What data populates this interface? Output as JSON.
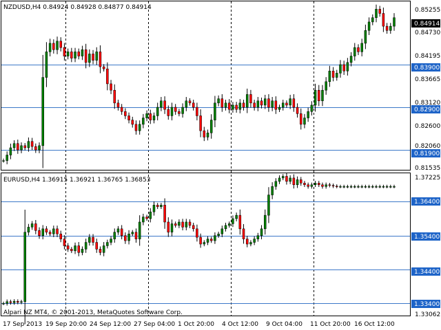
{
  "top": {
    "title": "NZDUSD,H4  0.84924 0.84928 0.84877 0.84914",
    "current_price": "0.84914",
    "price_ticks": [
      "0.85255",
      "0.84730",
      "0.84195",
      "0.83665",
      "0.83120",
      "0.82600",
      "0.82060",
      "0.81535"
    ],
    "level_labels": [
      "0.83900",
      "0.82900",
      "0.81900"
    ]
  },
  "bottom": {
    "title": "EURUSD,H4  1.36915 1.36921 1.36765 1.36853",
    "price_ticks": [
      "1.37225",
      "1.33062"
    ],
    "level_labels": [
      "1.36400",
      "1.35400",
      "1.34400",
      "1.33400"
    ]
  },
  "copyright": "Alpari NZ MT4, © 2001-2013, MetaQuotes Software Corp.",
  "time_labels": [
    "17 Sep 2013",
    "19 Sep 20:00",
    "24 Sep 12:00",
    "27 Sep 04:00",
    "1 Oct 20:00",
    "4 Oct 12:00",
    "9 Oct 04:00",
    "11 Oct 20:00",
    "16 Oct 12:00"
  ],
  "colors": {
    "up_candle": "#008000",
    "down_candle": "#ff0000",
    "bar_outline": "#000000",
    "level_line": "#3c78c8",
    "grid": "#000000",
    "label_highlight_bg": "#1e64c8",
    "current_price_bg": "#000000"
  },
  "chart_data": [
    {
      "type": "candlestick",
      "title": "NZDUSD,H4  0.84924 0.84928 0.84877 0.84914",
      "series": [
        {
          "name": "NZDUSD",
          "close": [
            0.8165,
            0.8178,
            0.8195,
            0.8205,
            0.819,
            0.82,
            0.8195,
            0.821,
            0.8198,
            0.819,
            0.82,
            0.836,
            0.842,
            0.844,
            0.8425,
            0.8445,
            0.843,
            0.841,
            0.842,
            0.8405,
            0.842,
            0.841,
            0.8425,
            0.8395,
            0.8415,
            0.84,
            0.842,
            0.8385,
            0.838,
            0.8345,
            0.833,
            0.83,
            0.829,
            0.828,
            0.827,
            0.826,
            0.825,
            0.8235,
            0.825,
            0.8265,
            0.8275,
            0.826,
            0.827,
            0.829,
            0.8305,
            0.8285,
            0.827,
            0.829,
            0.828,
            0.8275,
            0.829,
            0.8305,
            0.83,
            0.829,
            0.827,
            0.8235,
            0.822,
            0.823,
            0.826,
            0.83,
            0.831,
            0.829,
            0.83,
            0.8285,
            0.8295,
            0.8285,
            0.83,
            0.829,
            0.832,
            0.83,
            0.829,
            0.8305,
            0.8295,
            0.831,
            0.829,
            0.8305,
            0.8285,
            0.829,
            0.83,
            0.8295,
            0.831,
            0.829,
            0.8275,
            0.825,
            0.8265,
            0.828,
            0.8295,
            0.833,
            0.8305,
            0.833,
            0.835,
            0.8375,
            0.836,
            0.837,
            0.839,
            0.8375,
            0.8395,
            0.841,
            0.843,
            0.842,
            0.844,
            0.847,
            0.849,
            0.85,
            0.852,
            0.851,
            0.848,
            0.847,
            0.848,
            0.85
          ]
        }
      ],
      "levels": [
        0.839,
        0.829,
        0.819
      ],
      "ylim": [
        0.8145,
        0.8535
      ]
    },
    {
      "type": "candlestick",
      "title": "EURUSD,H4  1.36915 1.36921 1.36765 1.36853",
      "series": [
        {
          "name": "EURUSD",
          "close": [
            1.334,
            1.3345,
            1.3342,
            1.3346,
            1.3343,
            1.3345,
            1.355,
            1.3565,
            1.3575,
            1.3555,
            1.354,
            1.356,
            1.355,
            1.3545,
            1.356,
            1.3545,
            1.353,
            1.351,
            1.35,
            1.3495,
            1.351,
            1.349,
            1.35,
            1.352,
            1.3535,
            1.352,
            1.35,
            1.349,
            1.351,
            1.352,
            1.353,
            1.355,
            1.356,
            1.354,
            1.3525,
            1.3545,
            1.355,
            1.353,
            1.358,
            1.3595,
            1.359,
            1.361,
            1.363,
            1.3625,
            1.363,
            1.358,
            1.355,
            1.3575,
            1.357,
            1.358,
            1.3565,
            1.358,
            1.357,
            1.356,
            1.3535,
            1.3515,
            1.352,
            1.353,
            1.3525,
            1.354,
            1.3545,
            1.356,
            1.357,
            1.3575,
            1.359,
            1.36,
            1.356,
            1.353,
            1.3515,
            1.352,
            1.353,
            1.354,
            1.356,
            1.36,
            1.366,
            1.3685,
            1.37,
            1.371,
            1.3715,
            1.37,
            1.371,
            1.369,
            1.3705,
            1.3695,
            1.369,
            1.3685,
            1.369,
            1.3695,
            1.369,
            1.3685,
            1.369,
            1.3688,
            1.3686,
            1.3685,
            1.3685,
            1.3685,
            1.3685,
            1.3685,
            1.3685,
            1.3685,
            1.3685,
            1.3685,
            1.3685,
            1.3685,
            1.3685,
            1.3685,
            1.3685,
            1.3685,
            1.3685,
            1.3685
          ]
        }
      ],
      "levels": [
        1.364,
        1.354,
        1.344,
        1.334
      ],
      "ylim": [
        1.3306,
        1.3722
      ]
    }
  ]
}
